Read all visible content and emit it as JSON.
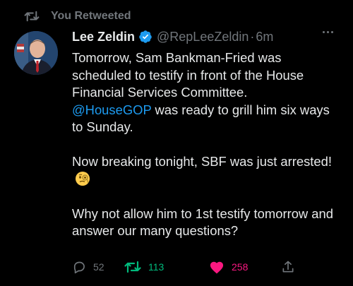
{
  "social_context": {
    "label": "You Retweeted",
    "icon": "retweet-icon"
  },
  "author": {
    "name": "Lee Zeldin",
    "verified": true,
    "handle": "@RepLeeZeldin",
    "separator": "·",
    "time": "6m",
    "avatar_icon": "profile-photo"
  },
  "tweet": {
    "line1": "Tomorrow, Sam Bankman-Fried was scheduled to testify in front of the House Financial Services Committee.",
    "mention": "@HouseGOP",
    "line1_after_mention": " was ready to grill him six ways to Sunday.",
    "para2": "Now breaking tonight, SBF was just arrested!",
    "para2_emoji": "face-with-monocle-emoji",
    "para3": "Why not allow him to 1st testify tomorrow and answer our many questions?"
  },
  "actions": {
    "reply_count": "52",
    "retweet_count": "113",
    "like_count": "258",
    "retweeted": true,
    "liked": true
  },
  "colors": {
    "background": "#000000",
    "text": "#e7e9ea",
    "muted": "#71767b",
    "link": "#1d9bf0",
    "retweet_active": "#00ba7c",
    "like_active": "#f91880",
    "verified": "#1d9bf0"
  }
}
